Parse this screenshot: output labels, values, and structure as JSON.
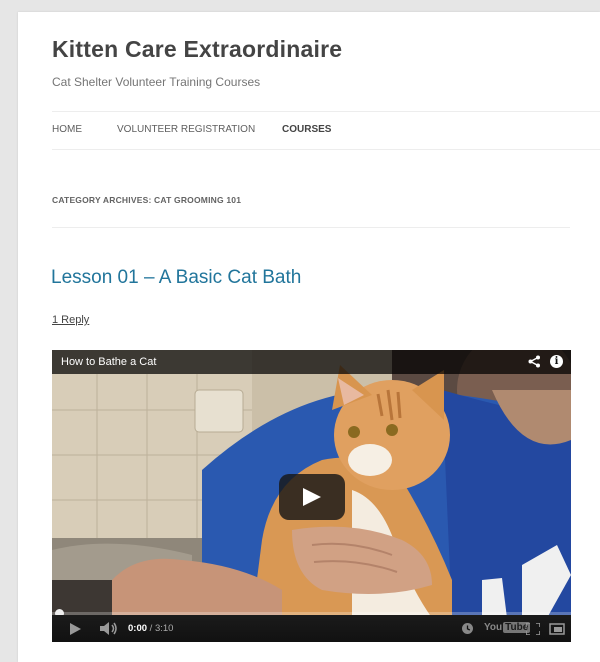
{
  "site": {
    "title": "Kitten Care Extraordinaire",
    "description": "Cat Shelter Volunteer Training Courses"
  },
  "nav": {
    "items": [
      {
        "label": "HOME",
        "current": false
      },
      {
        "label": "VOLUNTEER REGISTRATION",
        "current": false
      },
      {
        "label": "COURSES",
        "current": true
      }
    ]
  },
  "archive": {
    "title": "CATEGORY ARCHIVES: CAT GROOMING 101"
  },
  "post": {
    "title": "Lesson 01 – A Basic Cat Bath",
    "reply_link": "1 Reply"
  },
  "video": {
    "title": "How to Bathe a Cat",
    "current_time": "0:00",
    "separator": " / ",
    "duration": "3:10",
    "progress": 0,
    "logo_you": "You",
    "logo_tube": "Tube",
    "icons": [
      "share-icon",
      "info-icon",
      "play-icon",
      "volume-icon",
      "watch-later-icon",
      "fullscreen-icon",
      "cast-icon"
    ]
  },
  "colors": {
    "link": "#21759b",
    "background": "#e6e6e6",
    "page": "#ffffff"
  }
}
